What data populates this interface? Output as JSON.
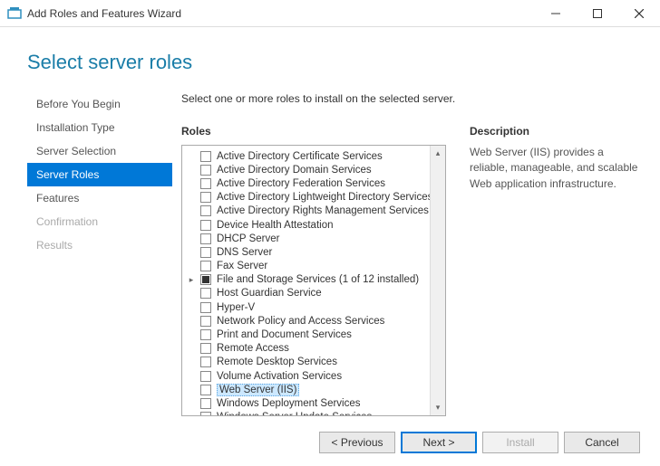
{
  "titlebar": {
    "title": "Add Roles and Features Wizard"
  },
  "heading": "Select server roles",
  "sidebar": {
    "items": [
      {
        "label": "Before You Begin",
        "state": "normal"
      },
      {
        "label": "Installation Type",
        "state": "normal"
      },
      {
        "label": "Server Selection",
        "state": "normal"
      },
      {
        "label": "Server Roles",
        "state": "active"
      },
      {
        "label": "Features",
        "state": "normal"
      },
      {
        "label": "Confirmation",
        "state": "disabled"
      },
      {
        "label": "Results",
        "state": "disabled"
      }
    ]
  },
  "instruction": "Select one or more roles to install on the selected server.",
  "roles_header": "Roles",
  "description_header": "Description",
  "description_text": "Web Server (IIS) provides a reliable, manageable, and scalable Web application infrastructure.",
  "roles": [
    {
      "label": "Active Directory Certificate Services",
      "checked": false
    },
    {
      "label": "Active Directory Domain Services",
      "checked": false
    },
    {
      "label": "Active Directory Federation Services",
      "checked": false
    },
    {
      "label": "Active Directory Lightweight Directory Services",
      "checked": false
    },
    {
      "label": "Active Directory Rights Management Services",
      "checked": false
    },
    {
      "label": "Device Health Attestation",
      "checked": false
    },
    {
      "label": "DHCP Server",
      "checked": false
    },
    {
      "label": "DNS Server",
      "checked": false
    },
    {
      "label": "Fax Server",
      "checked": false
    },
    {
      "label": "File and Storage Services (1 of 12 installed)",
      "checked": "partial",
      "expandable": true
    },
    {
      "label": "Host Guardian Service",
      "checked": false
    },
    {
      "label": "Hyper-V",
      "checked": false
    },
    {
      "label": "Network Policy and Access Services",
      "checked": false
    },
    {
      "label": "Print and Document Services",
      "checked": false
    },
    {
      "label": "Remote Access",
      "checked": false
    },
    {
      "label": "Remote Desktop Services",
      "checked": false
    },
    {
      "label": "Volume Activation Services",
      "checked": false
    },
    {
      "label": "Web Server (IIS)",
      "checked": false,
      "selected": true
    },
    {
      "label": "Windows Deployment Services",
      "checked": false
    },
    {
      "label": "Windows Server Update Services",
      "checked": false
    }
  ],
  "buttons": {
    "previous": "< Previous",
    "next": "Next >",
    "install": "Install",
    "cancel": "Cancel"
  }
}
